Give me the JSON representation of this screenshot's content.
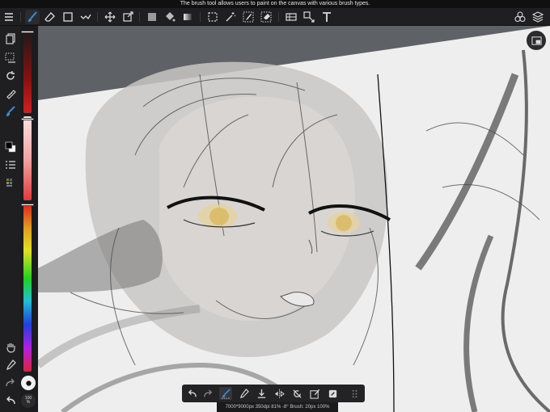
{
  "tooltip": "The brush tool allows users to paint on the canvas with various brush types.",
  "status": "7000*9000px 350dpi 81% -8° Brush: 20px 100%",
  "zoom": {
    "value": "100",
    "unit": "%"
  },
  "colors": {
    "toolbar_bg": "#1f1f21",
    "canvas_bg": "#5e6166",
    "accent": "#3d8bd6",
    "primary_color": "#000000",
    "secondary_color": "#ffffff"
  },
  "sliders": {
    "brush_size_fraction": 0.02,
    "opacity_fraction": 0.02,
    "hue_fraction": 0.0
  },
  "top_toolbar": {
    "items": [
      "menu-icon",
      "brush-icon",
      "eraser-icon",
      "rectangle-icon",
      "line-icon",
      "move-icon",
      "transform-icon",
      "fill-color-icon",
      "bucket-icon",
      "gradient-icon",
      "select-icon",
      "magic-wand-icon",
      "select-pen-icon",
      "select-eraser-icon",
      "filter-icon",
      "resize-icon",
      "text-icon",
      "materials-icon",
      "layers-icon"
    ]
  },
  "bottom_toolbar": {
    "items": [
      "undo-icon",
      "redo-icon",
      "brush-select-icon",
      "eyedropper-icon",
      "save-icon",
      "flip-icon",
      "no-rotate-icon",
      "edit-icon",
      "clipboard-icon",
      "grip-icon"
    ]
  }
}
